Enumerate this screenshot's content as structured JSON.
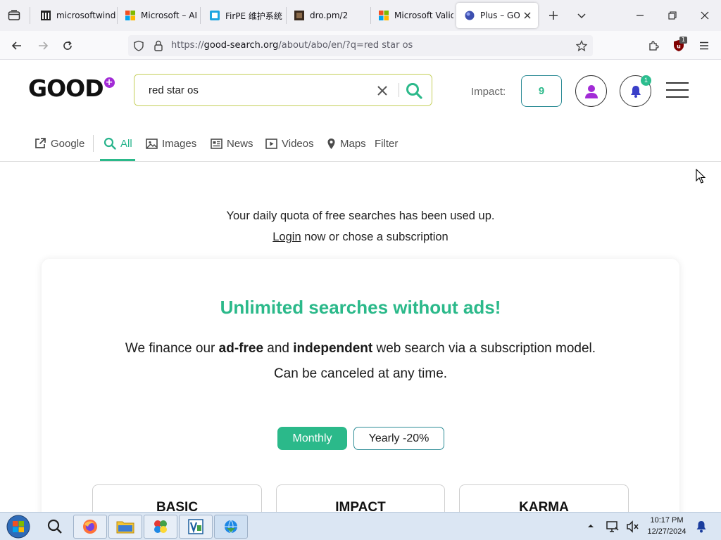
{
  "browser": {
    "tabs": [
      {
        "title": "microsoftwindows",
        "icon": "archive-favicon"
      },
      {
        "title": "Microsoft – AI",
        "icon": "microsoft-favicon"
      },
      {
        "title": "FirPE 维护系统",
        "icon": "firpe-favicon"
      },
      {
        "title": "dro.pm/2",
        "icon": "dro-favicon"
      },
      {
        "title": "Microsoft Valid",
        "icon": "microsoft-favicon"
      },
      {
        "title": "Plus – GOOD",
        "icon": "globe-favicon",
        "active": true
      }
    ],
    "url": {
      "prefix": "https://",
      "domain": "good-search.org",
      "path": "/about/abo/en/?q=red star os"
    },
    "extension_badge": "1"
  },
  "site": {
    "logo_text": "GOOD",
    "logo_badge": "+",
    "search": {
      "value": "red star os",
      "placeholder": ""
    },
    "impact_label": "Impact:",
    "impact_value": "9",
    "notification_count": "1",
    "categories": [
      {
        "label": "Google",
        "icon": "external-link-icon"
      },
      {
        "label": "All",
        "icon": "search-icon",
        "active": true
      },
      {
        "label": "Images",
        "icon": "image-icon"
      },
      {
        "label": "News",
        "icon": "news-icon"
      },
      {
        "label": "Videos",
        "icon": "video-icon"
      },
      {
        "label": "Maps",
        "icon": "map-pin-icon"
      },
      {
        "label": "Filter",
        "icon": ""
      }
    ]
  },
  "main": {
    "quota_line": "Your daily quota of free searches has been used up.",
    "login_link": "Login",
    "login_rest": " now or chose a subscription",
    "card": {
      "title": "Unlimited searches without ads!",
      "desc_1": "We finance our ",
      "desc_bold_1": "ad-free",
      "desc_2": " and ",
      "desc_bold_2": "independent",
      "desc_3": " web search via a subscription model.",
      "desc_line2": "Can be canceled at any time.",
      "toggle_monthly": "Monthly",
      "toggle_yearly": "Yearly -20%",
      "plans": [
        "BASIC",
        "IMPACT",
        "KARMA"
      ]
    }
  },
  "taskbar": {
    "time": "10:17 PM",
    "date": "12/27/2024"
  },
  "colors": {
    "accent": "#2bb98a",
    "logo_badge": "#a22bd6",
    "search_border": "#c4cf58"
  }
}
